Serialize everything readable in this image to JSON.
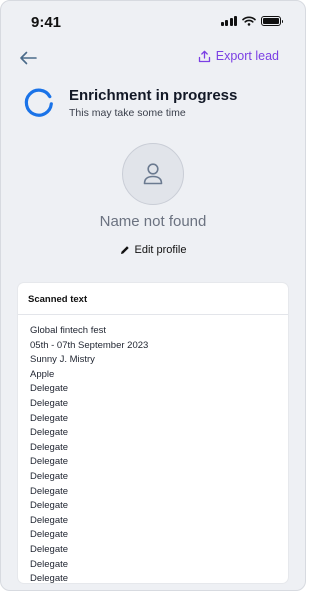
{
  "status_bar": {
    "time": "9:41"
  },
  "nav": {
    "export_label": "Export lead"
  },
  "enrichment": {
    "title": "Enrichment in progress",
    "subtitle": "This may take some time"
  },
  "profile": {
    "name": "Name not found",
    "edit_label": "Edit profile"
  },
  "scanned": {
    "title": "Scanned text",
    "lines": [
      "Global fintech fest",
      "05th - 07th September 2023",
      "Sunny J. Mistry",
      "Apple",
      "Delegate",
      "Delegate",
      "Delegate",
      "Delegate",
      "Delegate",
      "Delegate",
      "Delegate",
      "Delegate",
      "Delegate",
      "Delegate",
      "Delegate",
      "Delegate",
      "Delegate",
      "Delegate"
    ]
  },
  "colors": {
    "accent": "#7b3fe4",
    "spinner": "#1a73e8",
    "background": "#eef0f4"
  },
  "icons": [
    "back-arrow-icon",
    "export-icon",
    "spinner-icon",
    "user-icon",
    "pencil-icon",
    "signal-icon",
    "wifi-icon",
    "battery-icon"
  ]
}
